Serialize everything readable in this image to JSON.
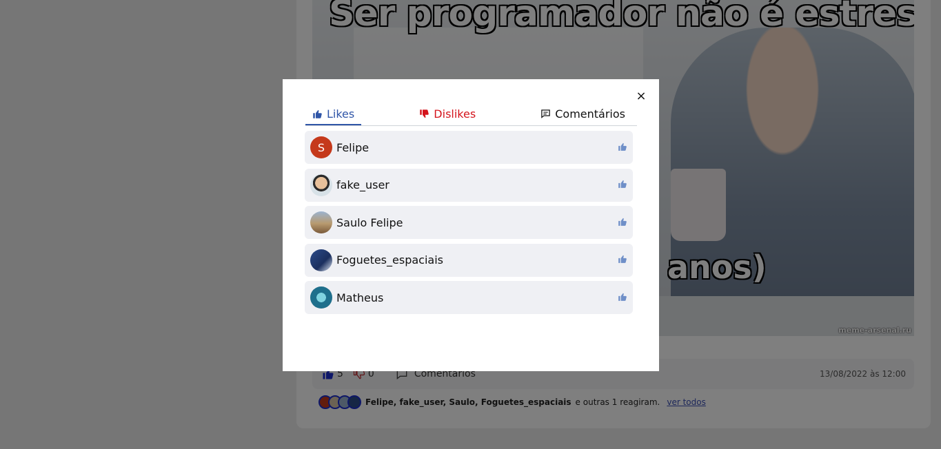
{
  "post": {
    "meme_top_text": "Ser programador não é estressante",
    "meme_bottom_text": "anos)",
    "watermark": "meme-arsenal.ru",
    "likes_count": "5",
    "dislikes_count": "0",
    "comments_label": "Comentarios",
    "date": "13/08/2022 às 12:00",
    "reactions_names": "Felipe, fake_user, Saulo, Foguetes_espaciais",
    "reactions_rest": "e outras 1 reagiram.",
    "see_all": "ver todos"
  },
  "modal": {
    "close_label": "×",
    "tabs": [
      {
        "label": "Likes",
        "icon": "thumbs-up-icon",
        "color": "#2f55a7",
        "active": true
      },
      {
        "label": "Dislikes",
        "icon": "thumbs-down-icon",
        "color": "#d4141c",
        "active": false
      },
      {
        "label": "Comentários",
        "icon": "comment-icon",
        "color": "#111111",
        "active": false
      }
    ],
    "likes": [
      {
        "name": "Felipe",
        "avatar_letter": "S"
      },
      {
        "name": "fake_user",
        "avatar_letter": ""
      },
      {
        "name": "Saulo Felipe",
        "avatar_letter": ""
      },
      {
        "name": "Foguetes_espaciais",
        "avatar_letter": ""
      },
      {
        "name": "Matheus",
        "avatar_letter": ""
      }
    ]
  },
  "colors": {
    "like_icon": "#6f8fc8",
    "overlay": "rgba(0,0,0,0.5)",
    "row_bg": "#eff0f4"
  }
}
